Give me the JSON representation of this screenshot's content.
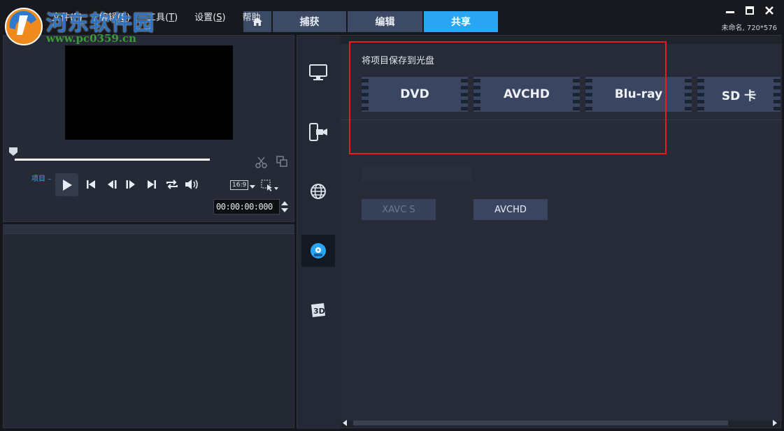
{
  "watermark": {
    "title": "河东软件园",
    "url": "www.pc0359.cn"
  },
  "menu": [
    {
      "label": "文件",
      "key": "F"
    },
    {
      "label": "编辑",
      "key": "E"
    },
    {
      "label": "工具",
      "key": "T"
    },
    {
      "label": "设置",
      "key": "S"
    },
    {
      "label": "帮助",
      "key": ""
    }
  ],
  "tabs": {
    "capture": "捕获",
    "edit": "编辑",
    "share": "共享"
  },
  "window": {
    "project_info": "未命名, 720*576"
  },
  "player": {
    "project_label": "项目 –",
    "aspect_ratio": "16:9",
    "timecode": "00:00:00:000"
  },
  "share": {
    "disc_title": "将项目保存到光盘",
    "disc_options": [
      "DVD",
      "AVCHD",
      "Blu-ray",
      "SD 卡"
    ],
    "format_buttons": [
      {
        "label": "XAVC S",
        "enabled": false
      },
      {
        "label": "AVCHD",
        "enabled": true
      }
    ],
    "sidebar": [
      "computer-icon",
      "device-icon",
      "web-icon",
      "disc-icon",
      "3d-icon"
    ]
  },
  "colors": {
    "accent": "#2aa5f3",
    "highlight": "#e41d1d",
    "tab": "#3c4a66"
  }
}
